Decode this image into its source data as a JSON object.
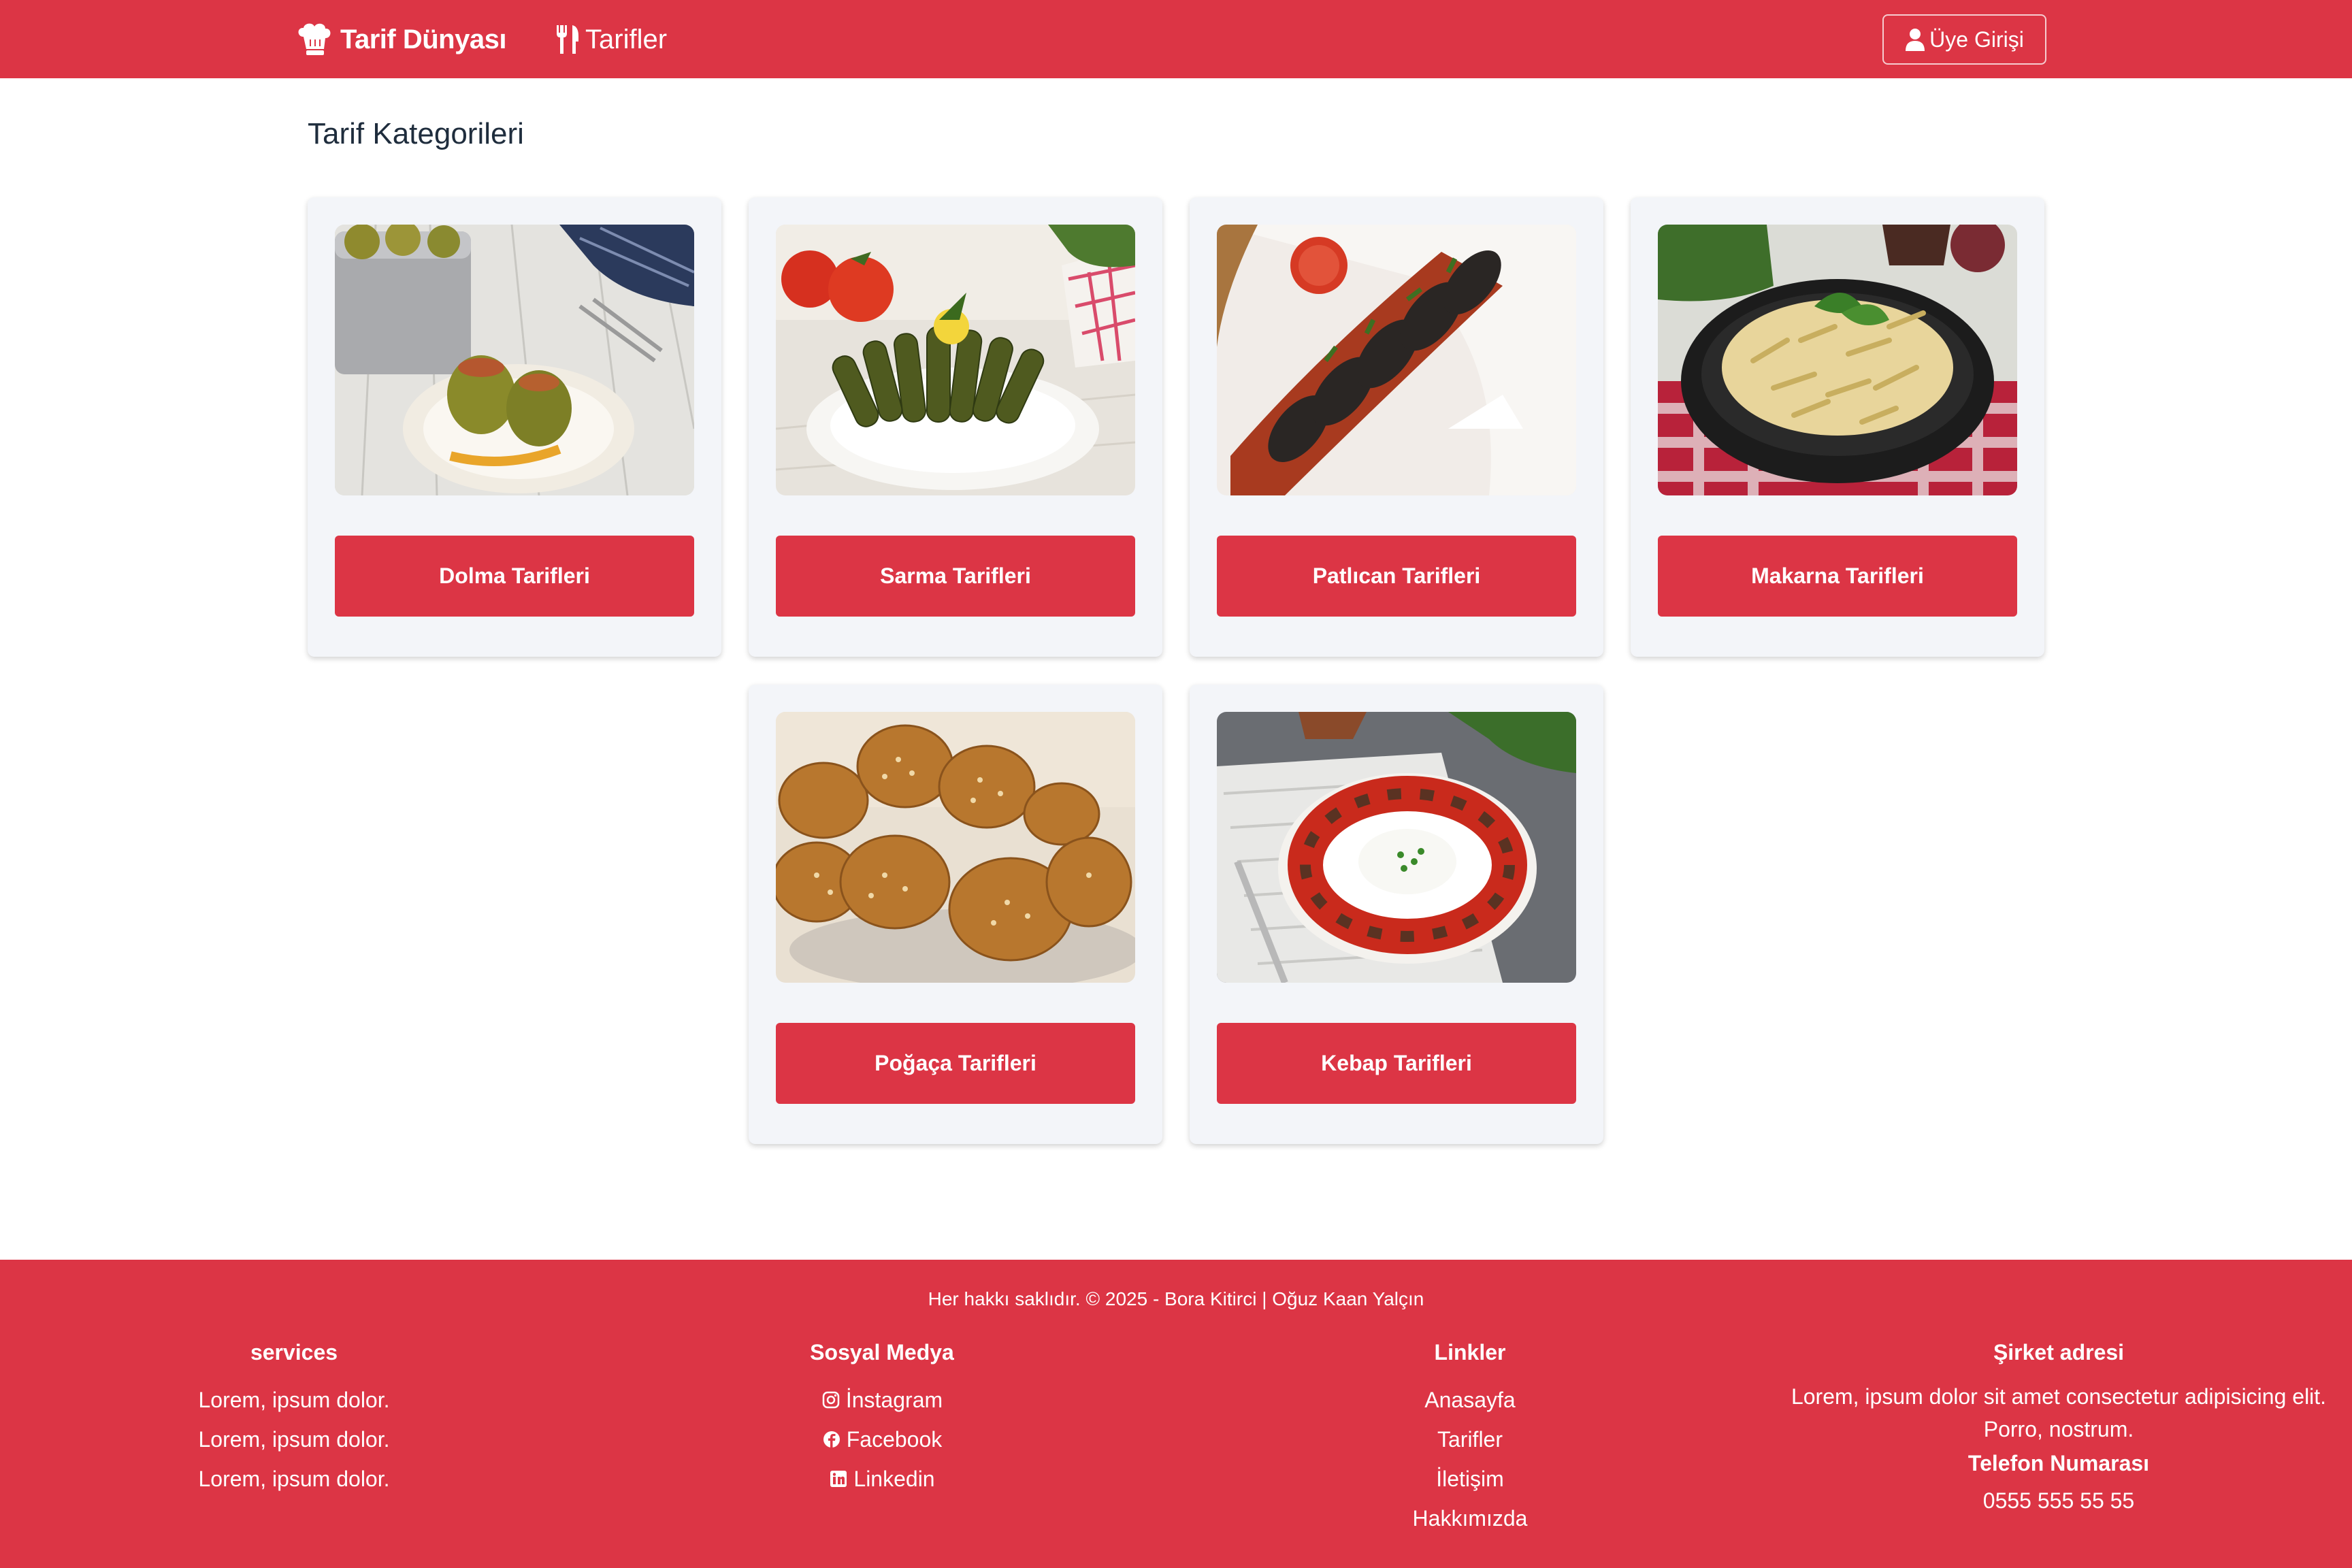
{
  "nav": {
    "brand": "Tarif Dünyası",
    "brand_icon": "chef-hat-icon",
    "recipes_link": "Tarifler",
    "recipes_icon": "utensils-icon",
    "login": "Üye Girişi",
    "login_icon": "user-icon",
    "color": "#dc3545"
  },
  "page": {
    "title": "Tarif Kategorileri"
  },
  "categories": [
    {
      "label": "Dolma Tarifleri",
      "image": "stuffed-peppers-photo"
    },
    {
      "label": "Sarma Tarifleri",
      "image": "stuffed-grape-leaves-photo"
    },
    {
      "label": "Patlıcan Tarifleri",
      "image": "eggplant-kebab-photo"
    },
    {
      "label": "Makarna Tarifleri",
      "image": "pasta-photo"
    },
    {
      "label": "Poğaça Tarifleri",
      "image": "sesame-pastry-photo"
    },
    {
      "label": "Kebap Tarifleri",
      "image": "kebab-plate-photo"
    }
  ],
  "footer": {
    "copyright": "Her hakkı saklıdır. © 2025 - Bora Kitirci | Oğuz Kaan Yalçın",
    "services": {
      "title": "services",
      "items": [
        "Lorem, ipsum dolor.",
        "Lorem, ipsum dolor.",
        "Lorem, ipsum dolor."
      ]
    },
    "social": {
      "title": "Sosyal Medya",
      "items": [
        {
          "label": "İnstagram",
          "icon": "instagram-icon"
        },
        {
          "label": "Facebook",
          "icon": "facebook-icon"
        },
        {
          "label": "Linkedin",
          "icon": "linkedin-icon"
        }
      ]
    },
    "links": {
      "title": "Linkler",
      "items": [
        "Anasayfa",
        "Tarifler",
        "İletişim",
        "Hakkımızda"
      ]
    },
    "address": {
      "title": "Şirket adresi",
      "text": "Lorem, ipsum dolor sit amet consectetur adipisicing elit. Porro, nostrum.",
      "phone_title": "Telefon Numarası",
      "phone": "0555 555 55 55"
    }
  }
}
